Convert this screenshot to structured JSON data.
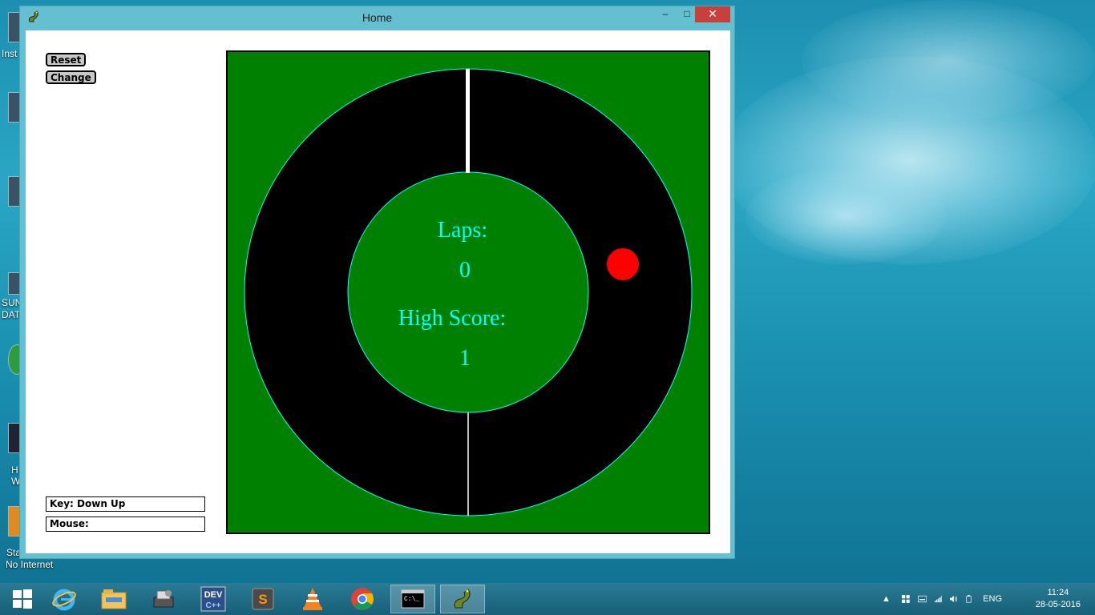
{
  "window": {
    "title": "Home",
    "controls": {
      "minimize": "–",
      "maximize": "□",
      "close": "✕"
    }
  },
  "controls": {
    "reset_label": "Reset",
    "change_label": "Change"
  },
  "status": {
    "key_text": "Key: Down Up",
    "mouse_text": "Mouse:"
  },
  "game": {
    "laps_label": "Laps:",
    "laps_value": "0",
    "high_score_label": "High Score:",
    "high_score_value": "1",
    "colors": {
      "field": "#008000",
      "track": "#000000",
      "outline": "#00ffff",
      "text": "#00ffff",
      "ball": "#ff0000"
    }
  },
  "desktop": {
    "labels": [
      "Inst",
      "SUN",
      "DAT",
      "H",
      "W",
      "Sta",
      "No Internet"
    ]
  },
  "taskbar": {
    "items": [
      "start-icon",
      "internet-explorer-icon",
      "file-explorer-icon",
      "printer-setup-icon",
      "dev-cpp-icon",
      "sublime-text-icon",
      "vlc-icon",
      "chrome-icon",
      "command-prompt-icon",
      "snake-app-icon"
    ],
    "tray": {
      "language": "ENG"
    },
    "clock": {
      "time": "11:24",
      "date": "28-05-2016"
    }
  }
}
